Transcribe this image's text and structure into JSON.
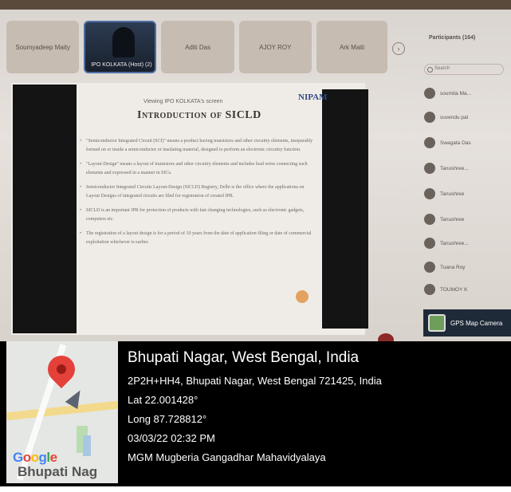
{
  "meeting": {
    "tiles": [
      {
        "label": "Soumyadeep Maity"
      },
      {
        "label": "IPO KOLKATA (Host) (2)",
        "video": true
      },
      {
        "label": "Aditi Das"
      },
      {
        "label": "AJOY ROY"
      },
      {
        "label": "Ark Maiti"
      }
    ],
    "next_glyph": "›"
  },
  "slide": {
    "viewing_text": "Viewing IPO KOLKATA's screen",
    "logo_text": "NIPAM",
    "title": "Introduction of SICLD",
    "bullets": [
      "\"Semiconductor Integrated Circuit (SCI)\" means a product having transistors and other circuitry elements, inseparably formed on or inside a semiconductor or insulating material, designed to perform an electronic circuitry function.",
      "\"Layout-Design\" means a layout of transistors and other circuitry elements and includes lead wires connecting such elements and expressed in a manner in SICs.",
      "Semiconductor Integrated Circuits Layout-Design (SICLD) Registry, Delhi is the office where the applications on Layout Designs of integrated circuits are filed for registration of created IPR.",
      "SICLD is an important IPR for protection of products with fast changing technologies, such as electronic gadgets, computers etc.",
      "The registration of a layout design is for a period of 10 years from the date of application filing or date of commercial exploitation whichever is earlier."
    ]
  },
  "participants": {
    "title": "Participants (164)",
    "search_placeholder": "Search",
    "items": [
      {
        "name": "soumita Ma..."
      },
      {
        "name": "suvendu pal"
      },
      {
        "name": "Swagata Das"
      },
      {
        "name": "Tanushree..."
      },
      {
        "name": "Tanushree"
      },
      {
        "name": "Tanushree"
      },
      {
        "name": "Tanushree..."
      },
      {
        "name": "Tuana Roy"
      },
      {
        "name": "TOUMOY K"
      }
    ]
  },
  "gps_app": {
    "label": "GPS Map Camera"
  },
  "gps_overlay": {
    "place": "Bhupati Nagar, West Bengal, India",
    "address": "2P2H+HH4, Bhupati Nagar, West Bengal 721425, India",
    "lat": "Lat 22.001428°",
    "long": "Long 87.728812°",
    "datetime": "03/03/22 02:32 PM",
    "institution": "MGM Mugberia Gangadhar Mahavidyalaya",
    "map_brand_letters": [
      "G",
      "o",
      "o",
      "g",
      "l",
      "e"
    ],
    "map_place_label": "Bhupati Nag",
    "pin_color": "#e4413b"
  }
}
